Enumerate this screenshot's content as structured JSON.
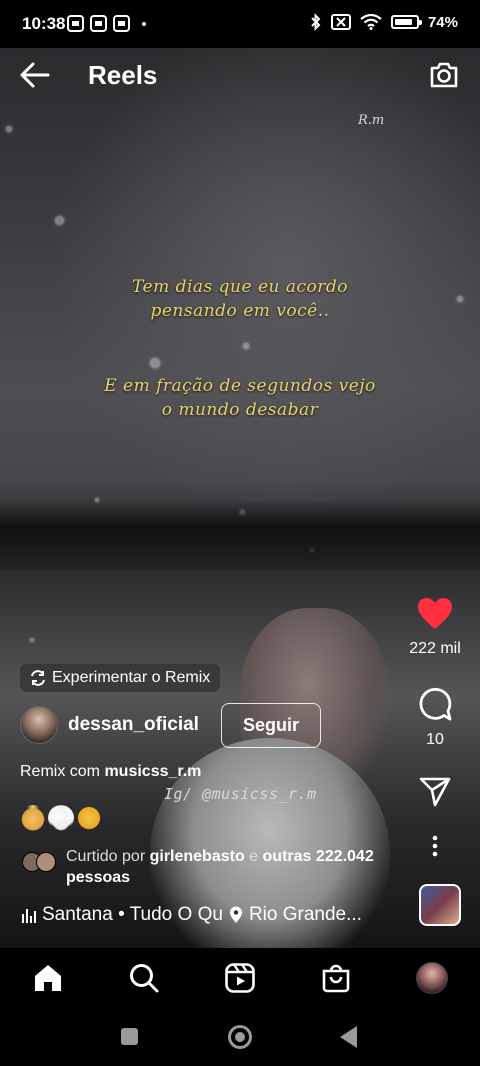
{
  "status_bar": {
    "time": "10:38",
    "battery": "74%"
  },
  "header": {
    "title": "Reels"
  },
  "video": {
    "watermark": "R.m",
    "lyrics_1": [
      "Tem dias que eu acordo",
      "pensando em você.."
    ],
    "lyrics_2": [
      "E em fração de segundos vejo",
      "o mundo desabar"
    ],
    "handle_overlay": "Ig/ @musicss_r.m"
  },
  "actions": {
    "likes": "222 mil",
    "comments": "10"
  },
  "remix_pill": "Experimentar o Remix",
  "author": {
    "name": "dessan_oficial",
    "follow_label": "Seguir"
  },
  "remix_line": {
    "prefix": "Remix com ",
    "user": "musicss_r.m"
  },
  "liked_by": {
    "prefix": "Curtido por ",
    "user": "girlenebasto",
    "middle": " e ",
    "others": "outras 222.042",
    "suffix": "pessoas"
  },
  "music": {
    "track": "Santana • Tudo O Qu",
    "location": "Rio Grande..."
  },
  "colors": {
    "like": "#ff3040",
    "lyrics": "#e7d46a"
  }
}
